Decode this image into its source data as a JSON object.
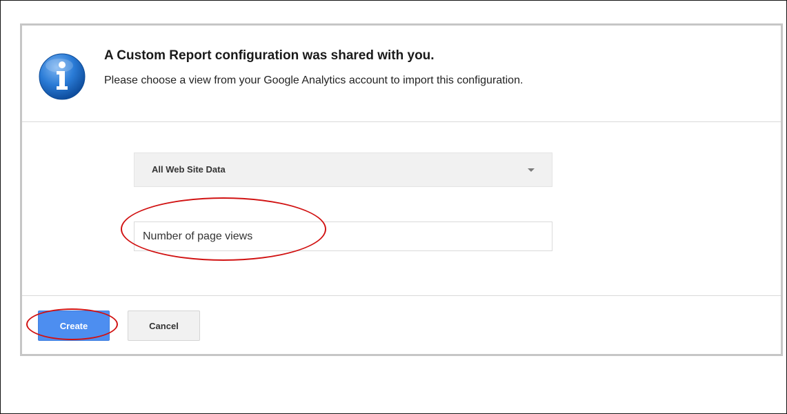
{
  "dialog": {
    "title": "A Custom Report configuration was shared with you.",
    "subtitle": "Please choose a view from your Google Analytics account to import this configuration.",
    "icon": "info-icon"
  },
  "view_select": {
    "selected_value": "All Web Site Data",
    "icon": "chevron-down-icon"
  },
  "name_input": {
    "value": "Number of page views"
  },
  "footer": {
    "create_label": "Create",
    "cancel_label": "Cancel"
  },
  "colors": {
    "primary_button": "#4d8ef0",
    "annotation": "#d11212",
    "info_icon": "#1f6fd0"
  }
}
